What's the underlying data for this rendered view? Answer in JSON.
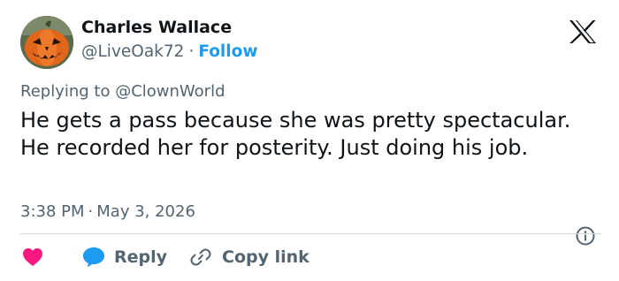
{
  "colors": {
    "text_primary": "#0f1419",
    "text_secondary": "#536471",
    "accent_blue": "#1d9bf0",
    "heart_pink": "#f91880",
    "divider": "#cfd9de"
  },
  "author": {
    "name": "Charles Wallace",
    "handle": "@LiveOak72",
    "separator": "·",
    "follow_label": "Follow",
    "avatar_icon": "pumpkin-avatar"
  },
  "platform": {
    "logo_icon": "x-logo-icon"
  },
  "tweet": {
    "replying_prefix": "Replying to",
    "replying_to": "@ClownWorld",
    "text": "He gets a pass because she was pretty spectacular. He recorded her for posterity. Just doing his job.",
    "time": "3:38 PM",
    "separator": "·",
    "date": "May 3, 2026"
  },
  "actions": {
    "like_icon": "heart-icon",
    "reply_icon": "speech-bubble-icon",
    "reply_label": "Reply",
    "copy_icon": "link-icon",
    "copy_label": "Copy link",
    "info_icon": "info-icon"
  }
}
